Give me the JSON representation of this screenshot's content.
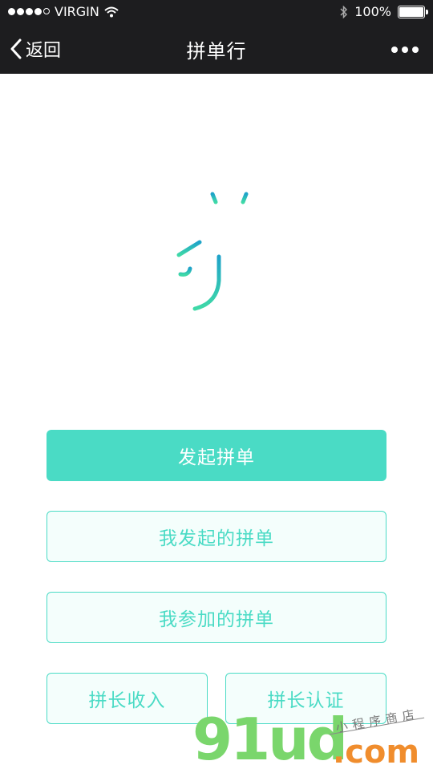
{
  "status_bar": {
    "carrier": "VIRGIN",
    "battery_percent": "100%",
    "signal_bars_filled": 4,
    "signal_bars_total": 5
  },
  "nav": {
    "back_label": "返回",
    "title": "拼单行",
    "more_icon": "ellipsis-icon"
  },
  "logo": {
    "text": "拼"
  },
  "buttons": {
    "start": "发起拼单",
    "my_started": "我发起的拼单",
    "my_joined": "我参加的拼单",
    "leader_income": "拼长收入",
    "leader_cert": "拼长认证"
  },
  "watermark": {
    "brand": "91ud",
    "domain": ".com",
    "note": "小程序商店"
  },
  "colors": {
    "accent": "#4adbc5",
    "header_bg": "#1d1d1f",
    "logo_top": "#1fa3c9",
    "logo_bottom": "#3fd9a7"
  }
}
